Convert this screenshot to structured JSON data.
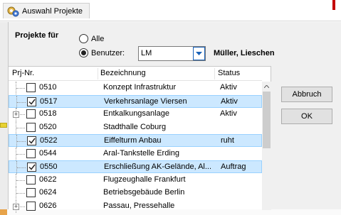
{
  "window": {
    "title": "Auswahl Projekte"
  },
  "filter": {
    "label": "Projekte für",
    "radio_all_label": "Alle",
    "radio_user_label": "Benutzer:",
    "selected_radio": "Benutzer",
    "user_code": "LM",
    "user_name": "Müller, Lieschen"
  },
  "list": {
    "columns": [
      "Prj-Nr.",
      "Bezeichnung",
      "Status"
    ],
    "rows": [
      {
        "nr": "0510",
        "bezeichnung": "Konzept Infrastruktur",
        "status": "Aktiv",
        "checked": false,
        "selected": false,
        "expandable": false
      },
      {
        "nr": "0517",
        "bezeichnung": "Verkehrsanlage Viersen",
        "status": "Aktiv",
        "checked": true,
        "selected": true,
        "expandable": false
      },
      {
        "nr": "0518",
        "bezeichnung": "Entkalkungsanlage",
        "status": "Aktiv",
        "checked": false,
        "selected": false,
        "expandable": true
      },
      {
        "nr": "0520",
        "bezeichnung": "Stadthalle Coburg",
        "status": "",
        "checked": false,
        "selected": false,
        "expandable": false
      },
      {
        "nr": "0522",
        "bezeichnung": "Eiffelturm Anbau",
        "status": "ruht",
        "checked": true,
        "selected": true,
        "expandable": false
      },
      {
        "nr": "0544",
        "bezeichnung": "Aral-Tankstelle Erding",
        "status": "",
        "checked": false,
        "selected": false,
        "expandable": false
      },
      {
        "nr": "0550",
        "bezeichnung": "Erschließung AK-Gelände, Al...",
        "status": "Auftrag",
        "checked": true,
        "selected": true,
        "expandable": false
      },
      {
        "nr": "0622",
        "bezeichnung": "Flugzeughalle Frankfurt",
        "status": "",
        "checked": false,
        "selected": false,
        "expandable": false
      },
      {
        "nr": "0624",
        "bezeichnung": "Betriebsgebäude Berlin",
        "status": "",
        "checked": false,
        "selected": false,
        "expandable": false
      },
      {
        "nr": "0626",
        "bezeichnung": "Passau, Pressehalle",
        "status": "",
        "checked": false,
        "selected": false,
        "expandable": true
      }
    ]
  },
  "buttons": {
    "cancel": "Abbruch",
    "ok": "OK"
  },
  "colors": {
    "selection_bg": "#cce8ff",
    "selection_border": "#99d1ff",
    "combo_button_border": "#1a62b8"
  }
}
